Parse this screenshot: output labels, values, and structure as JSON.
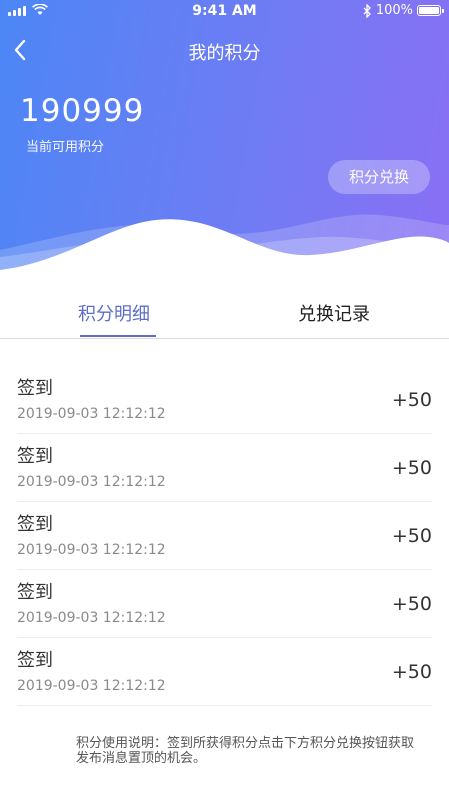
{
  "status_bar": {
    "time": "9:41 AM",
    "battery_text": "100%",
    "battery_level": 1.0,
    "icons": [
      "signal-icon",
      "wifi-icon",
      "bluetooth-icon",
      "battery-icon"
    ]
  },
  "nav": {
    "title": "我的积分",
    "back_icon": "chevron-left-icon"
  },
  "summary": {
    "points": "190999",
    "points_label": "当前可用积分",
    "exchange_label": "积分兑换"
  },
  "tabs": [
    {
      "label": "积分明细",
      "active": true
    },
    {
      "label": "兑换记录",
      "active": false
    }
  ],
  "records": [
    {
      "title": "签到",
      "time": "2019-09-03 12:12:12",
      "points": "+50"
    },
    {
      "title": "签到",
      "time": "2019-09-03 12:12:12",
      "points": "+50"
    },
    {
      "title": "签到",
      "time": "2019-09-03 12:12:12",
      "points": "+50"
    },
    {
      "title": "签到",
      "time": "2019-09-03 12:12:12",
      "points": "+50"
    },
    {
      "title": "签到",
      "time": "2019-09-03 12:12:12",
      "points": "+50"
    }
  ],
  "note": "积分使用说明：签到所获得积分点击下方积分兑换按钮获取发布消息置顶的机会。",
  "colors": {
    "header_gradient_start": "#4c86f5",
    "header_gradient_end": "#8a6ff4",
    "tab_active": "#5d6ec9"
  }
}
